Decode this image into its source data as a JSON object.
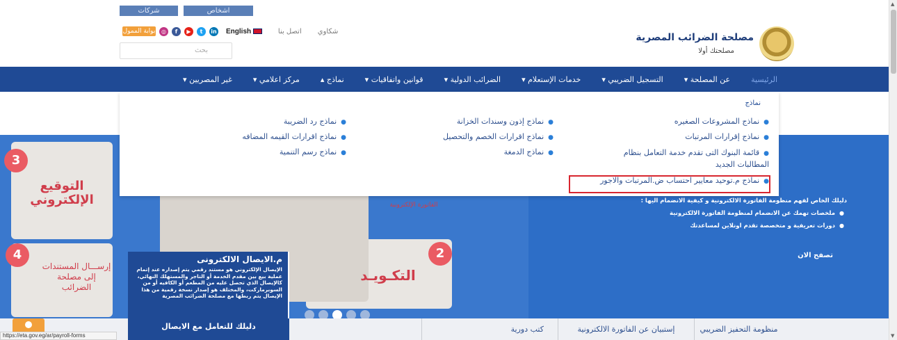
{
  "top_tabs": [
    "شركات",
    "اشخاص"
  ],
  "header": {
    "portal_button": "بوابة الممول",
    "lang_label": "English",
    "contact_link": "اتصل بنا",
    "complaints_link": "شكاوي",
    "search_placeholder": "بحث",
    "title": "مصلحة الضرائب المصرية",
    "slogan": "مصلحتك أولا"
  },
  "social_icons": [
    "instagram-icon",
    "facebook-icon",
    "youtube-icon",
    "twitter-icon",
    "linkedin-icon"
  ],
  "nav": {
    "home": "الرئيسية",
    "items": [
      "عن المصلحة ▾",
      "التسجيل الضريبي ▾",
      "خدمات الإستعلام ▾",
      "الضرائب الدولية ▾",
      "قوانين واتفاقيات ▾",
      "نماذج ▴",
      "مركز اعلامي ▾",
      "غير المصريين ▾"
    ]
  },
  "dropdown": {
    "heading": "نماذج",
    "col1": [
      "نماذج المشروعات الصغيره",
      "نماذج إقرارات المرتبات",
      "قائمة البنوك التى تقدم خدمة التعامل بنظام المطالبات الجديد",
      "نماذج م.توحيد معايير احتساب ض.المرتبات والاجور"
    ],
    "col2": [
      "نماذج إذون وسندات الخزانة",
      "نماذج اقرارات الخصم والتحصيل",
      "نماذج الدمغة"
    ],
    "col3": [
      "نماذج رد الضريبة",
      "نماذج اقرارات القيمه المضافه",
      "نماذج رسم التنمية"
    ]
  },
  "hero": {
    "step3_number": "3",
    "step3_title": "التوقيع الإلكتروني",
    "step4_number": "4",
    "step4_title": "إرســـال المستندات إلى مصلحة الضرائب",
    "step2_number": "2",
    "step2_title": "التكـويـد",
    "einvoice_label": "الفاتورة الإلكترونية",
    "panel_title": "م.الايصال الالكترونى",
    "panel_text": "الإيصال الإلكتروني هو مستند رقمي يتم إصداره عند إتمام عملية بيع بين مقدم الخدمة أو التاجر والمستهلك النهائي، كالإيصال الذي تحصل عليه من المطعم أو الكافيه أو من السوبرماركت، والمختلف هو إصدار نسخة رقمية من هذا الإيصال يتم ربطها مع مصلحة الضرائب المصرية",
    "right_title": "دليلك الخاص لفهم منظومة الفاتورة الالكترونية و كيفية الانضمام اليها :",
    "right_items": [
      "ملخصات تهمك عن الانضمام لمنظومة الفاتورة الالكترونية",
      "دورات تعريفية و متخصصة تقدم اونلاين لمساعدتك"
    ],
    "browse_now": "تصفح الان"
  },
  "bottom_tabs": [
    "منظومة التحفيز الضريبي",
    "إستبيان عن الفاتورة الالكترونية",
    "كتب دورية"
  ],
  "bottom_panel": "دليلك للتعامل مع الايصال",
  "status_url": "https://eta.gov.eg/ar/payroll-forms",
  "colors": {
    "brand_blue": "#1f4a95",
    "portal_orange": "#f2a03b",
    "highlight_red": "#d8262f",
    "accent_red": "#ea5b63"
  }
}
